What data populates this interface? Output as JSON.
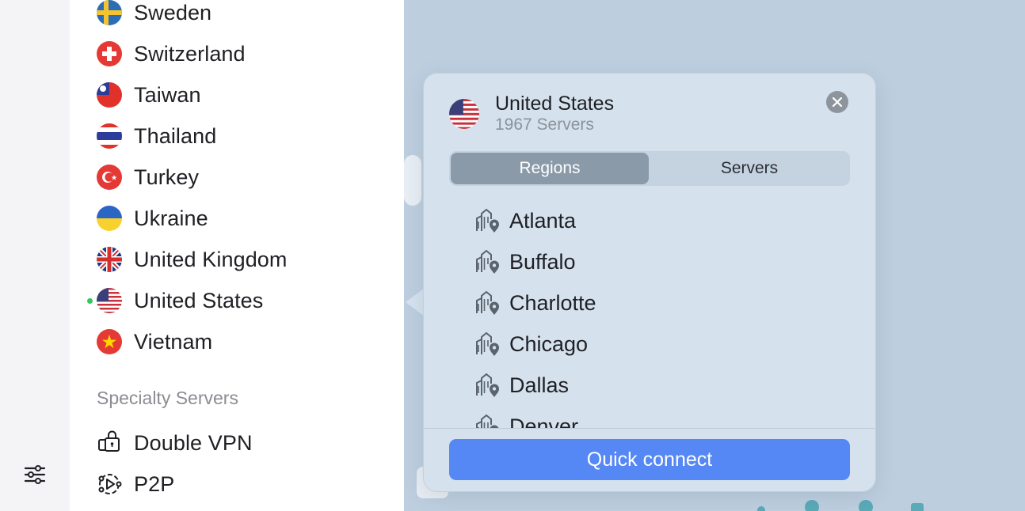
{
  "countries": [
    {
      "name": "Sweden",
      "flag": "flag-sweden-icon"
    },
    {
      "name": "Switzerland",
      "flag": "flag-switzerland-icon"
    },
    {
      "name": "Taiwan",
      "flag": "flag-taiwan-icon"
    },
    {
      "name": "Thailand",
      "flag": "flag-thailand-icon"
    },
    {
      "name": "Turkey",
      "flag": "flag-turkey-icon"
    },
    {
      "name": "Ukraine",
      "flag": "flag-ukraine-icon"
    },
    {
      "name": "United Kingdom",
      "flag": "flag-uk-icon"
    },
    {
      "name": "United States",
      "flag": "flag-us-icon",
      "connected": true
    },
    {
      "name": "Vietnam",
      "flag": "flag-vietnam-icon"
    }
  ],
  "specialty": {
    "title": "Specialty Servers",
    "items": [
      {
        "name": "Double VPN",
        "icon": "double-vpn-lock-icon"
      },
      {
        "name": "P2P",
        "icon": "p2p-icon"
      }
    ]
  },
  "popover": {
    "country": "United States",
    "server_count": "1967 Servers",
    "tabs": {
      "regions": "Regions",
      "servers": "Servers",
      "selected": "Regions"
    },
    "regions": [
      "Atlanta",
      "Buffalo",
      "Charlotte",
      "Chicago",
      "Dallas",
      "Denver"
    ],
    "quick_connect": "Quick connect"
  },
  "colors": {
    "accent": "#5688f5",
    "popover_bg": "#d5e2ee",
    "map_bg": "#bdcfdf",
    "connected_dot": "#34c759"
  }
}
